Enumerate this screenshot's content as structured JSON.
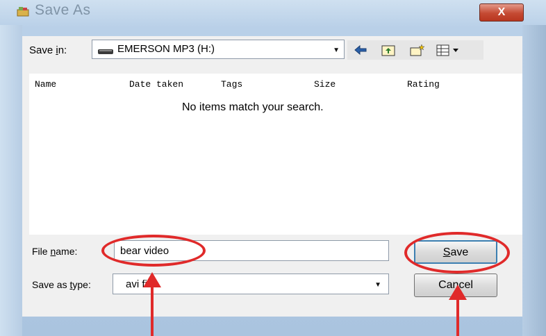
{
  "window": {
    "title": "Save As",
    "close_label": "X"
  },
  "savein": {
    "label_pre": "Save ",
    "label_hot": "i",
    "label_post": "n:",
    "value": "EMERSON MP3 (H:)",
    "icon": "drive-icon",
    "dropdown_icon": "chevron-down-icon"
  },
  "toolbar": {
    "icons": [
      "back-arrow-icon",
      "up-folder-icon",
      "new-folder-icon",
      "view-menu-icon"
    ]
  },
  "filelist": {
    "columns": [
      "Name",
      "Date taken",
      "Tags",
      "Size",
      "Rating"
    ],
    "empty_message": "No items match your search."
  },
  "filename": {
    "label_pre": "File ",
    "label_hot": "n",
    "label_post": "ame:",
    "value": "bear video"
  },
  "filetype": {
    "label_pre": "Save as ",
    "label_hot": "t",
    "label_post": "ype:",
    "value": "avi file"
  },
  "buttons": {
    "save_hot": "S",
    "save_rest": "ave",
    "cancel": "Cancel"
  },
  "annotations": {
    "color": "#e02a2a"
  }
}
